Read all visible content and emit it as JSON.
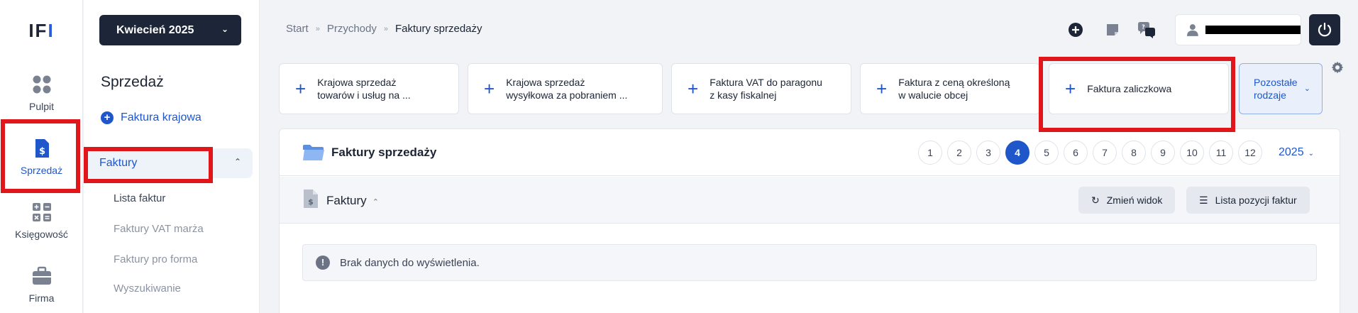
{
  "logo": {
    "text_a": "IF",
    "text_b": "I"
  },
  "rail": [
    {
      "label": "Pulpit",
      "icon": "dashboard-icon"
    },
    {
      "label": "Sprzedaż",
      "icon": "invoice-dollar-icon"
    },
    {
      "label": "Księgowość",
      "icon": "calculator-icon"
    },
    {
      "label": "Firma",
      "icon": "briefcase-icon"
    }
  ],
  "sidebar": {
    "month_label": "Kwiecień 2025",
    "title": "Sprzedaż",
    "new_invoice": "Faktura krajowa",
    "group_label": "Faktury",
    "items": [
      "Lista faktur",
      "Faktury VAT marża",
      "Faktury pro forma",
      "Wyszukiwanie"
    ]
  },
  "breadcrumb": [
    "Start",
    "Przychody",
    "Faktury sprzedaży"
  ],
  "cards": [
    {
      "line1": "Krajowa sprzedaż",
      "line2": "towarów i usług na ..."
    },
    {
      "line1": "Krajowa sprzedaż",
      "line2": "wysyłkowa za pobraniem ..."
    },
    {
      "line1": "Faktura VAT do paragonu",
      "line2": "z kasy fiskalnej"
    },
    {
      "line1": "Faktura z ceną określoną",
      "line2": "w walucie obcej"
    },
    {
      "line1": "Faktura zaliczkowa",
      "line2": ""
    }
  ],
  "other_types": {
    "line1": "Pozostałe",
    "line2": "rodzaje"
  },
  "panel": {
    "title": "Faktury sprzedaży",
    "months": [
      "1",
      "2",
      "3",
      "4",
      "5",
      "6",
      "7",
      "8",
      "9",
      "10",
      "11",
      "12"
    ],
    "active_month": "4",
    "year": "2025",
    "section_title": "Faktury",
    "btn_change_view": "Zmień widok",
    "btn_items_list": "Lista pozycji faktur",
    "empty_message": "Brak danych do wyświetlenia."
  },
  "colors": {
    "accent": "#1f56c9",
    "dark": "#1d2638",
    "highlight": "#e0161b"
  }
}
